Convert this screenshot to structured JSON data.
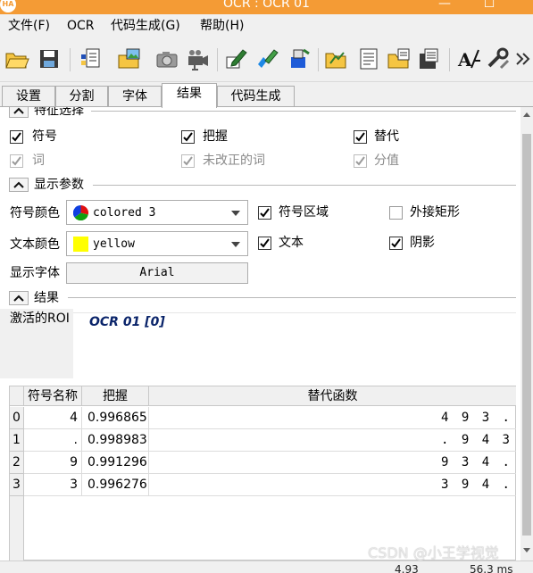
{
  "window": {
    "title": "OCR : OCR 01",
    "app_badge": "HA",
    "minimize": "—",
    "maximize": "☐"
  },
  "menu": [
    "文件(F)",
    "OCR",
    "代码生成(G)",
    "帮助(H)"
  ],
  "toolbar": {
    "icons": [
      "open-folder-icon",
      "save-disk-icon",
      "document-list-icon",
      "load-image-icon",
      "camera-icon",
      "video-camera-icon",
      "pen-edit-icon",
      "pen-edit-alt-icon",
      "brush-tool-icon",
      "open-folder-alt-icon",
      "document-text-icon",
      "folder-save-icon",
      "disk-save-alt-icon",
      "font-tool-icon",
      "settings-wrench-icon",
      "more-chevron-icon"
    ]
  },
  "tabs": [
    "设置",
    "分割",
    "字体",
    "结果",
    "代码生成"
  ],
  "active_tab": "结果",
  "feature_section": {
    "title": "特征选择",
    "checkboxes": [
      {
        "label": "符号",
        "checked": true,
        "enabled": true
      },
      {
        "label": "把握",
        "checked": true,
        "enabled": true
      },
      {
        "label": "替代",
        "checked": true,
        "enabled": true
      },
      {
        "label": "词",
        "checked": true,
        "enabled": false
      },
      {
        "label": "未改正的词",
        "checked": true,
        "enabled": false
      },
      {
        "label": "分值",
        "checked": true,
        "enabled": false
      }
    ]
  },
  "display_section": {
    "title": "显示参数",
    "symbol_color_label": "符号颜色",
    "symbol_color_value": "colored 3",
    "text_color_label": "文本颜色",
    "text_color_value": "yellow",
    "font_label": "显示字体",
    "font_value": "Arial",
    "checkboxes": [
      {
        "label": "符号区域",
        "checked": true
      },
      {
        "label": "外接矩形",
        "checked": false
      },
      {
        "label": "文本",
        "checked": true
      },
      {
        "label": "阴影",
        "checked": true
      }
    ],
    "colors": {
      "yellow": "#ffff00",
      "red": "#e01010",
      "green": "#10a010",
      "blue": "#1040e0"
    }
  },
  "result_section": {
    "title": "结果",
    "roi_label": "激活的ROI",
    "roi_value": "OCR 01 [0]"
  },
  "table": {
    "columns": [
      "符号名称",
      "把握",
      "替代函数"
    ],
    "rows": [
      {
        "index": "0",
        "symbol": "4",
        "confidence": "0.996865",
        "alternatives": "4 9 3 ."
      },
      {
        "index": "1",
        "symbol": ".",
        "confidence": "0.998983",
        "alternatives": ". 9 4 3"
      },
      {
        "index": "2",
        "symbol": "9",
        "confidence": "0.991296",
        "alternatives": "9 3 4 ."
      },
      {
        "index": "3",
        "symbol": "3",
        "confidence": "0.996276",
        "alternatives": "3 9 4 ."
      }
    ]
  },
  "status": {
    "value_a": "4.93",
    "value_b": "56.3 ms"
  },
  "watermark": "CSDN @小王学视觉"
}
